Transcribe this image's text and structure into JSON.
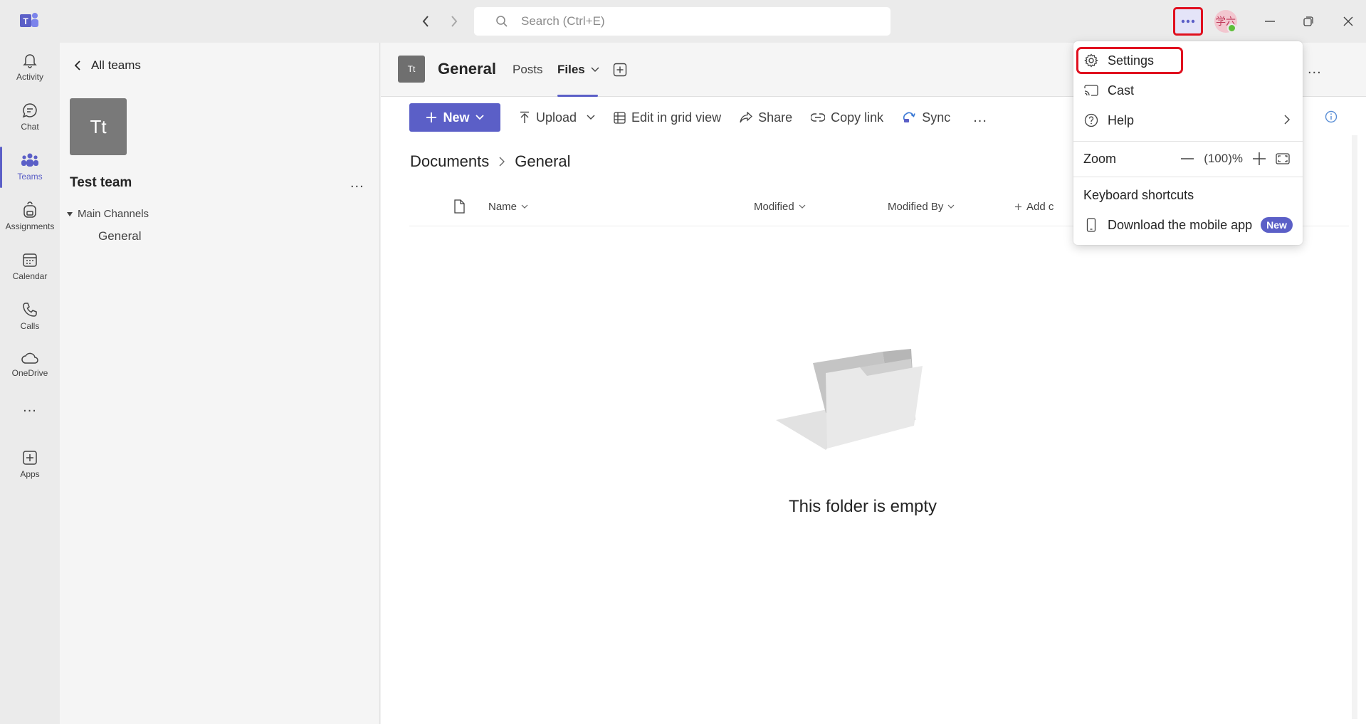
{
  "titlebar": {
    "search_placeholder": "Search (Ctrl+E)",
    "avatar_initials": "学六"
  },
  "rail": {
    "items": [
      {
        "label": "Activity",
        "icon": "bell-icon"
      },
      {
        "label": "Chat",
        "icon": "chat-icon"
      },
      {
        "label": "Teams",
        "icon": "teams-icon",
        "active": true
      },
      {
        "label": "Assignments",
        "icon": "backpack-icon"
      },
      {
        "label": "Calendar",
        "icon": "calendar-icon"
      },
      {
        "label": "Calls",
        "icon": "phone-icon"
      },
      {
        "label": "OneDrive",
        "icon": "cloud-icon"
      },
      {
        "label": "Apps",
        "icon": "add-app-icon"
      }
    ],
    "more": "..."
  },
  "team_panel": {
    "back_label": "All teams",
    "avatar_initials": "Tt",
    "team_name": "Test team",
    "more": "...",
    "section_label": "Main Channels",
    "channels": [
      "General"
    ]
  },
  "channel_header": {
    "avatar_initials": "Tt",
    "title": "General",
    "tabs": [
      "Posts",
      "Files"
    ],
    "more": "..."
  },
  "toolbar": {
    "new_label": "New",
    "upload_label": "Upload",
    "grid_label": "Edit in grid view",
    "share_label": "Share",
    "copy_link_label": "Copy link",
    "sync_label": "Sync",
    "more": "..."
  },
  "breadcrumb": [
    "Documents",
    "General"
  ],
  "columns": {
    "name": "Name",
    "modified": "Modified",
    "modified_by": "Modified By",
    "add_column": "Add c"
  },
  "empty_state": {
    "message": "This folder is empty"
  },
  "menu": {
    "settings": "Settings",
    "cast": "Cast",
    "help": "Help",
    "zoom_label": "Zoom",
    "zoom_value": "(100)%",
    "keyboard_shortcuts": "Keyboard shortcuts",
    "download_app": "Download the mobile app",
    "new_badge": "New"
  },
  "colors": {
    "accent": "#5b5fc7",
    "highlight_red": "#e0101f",
    "rail_bg": "#ebebeb"
  }
}
